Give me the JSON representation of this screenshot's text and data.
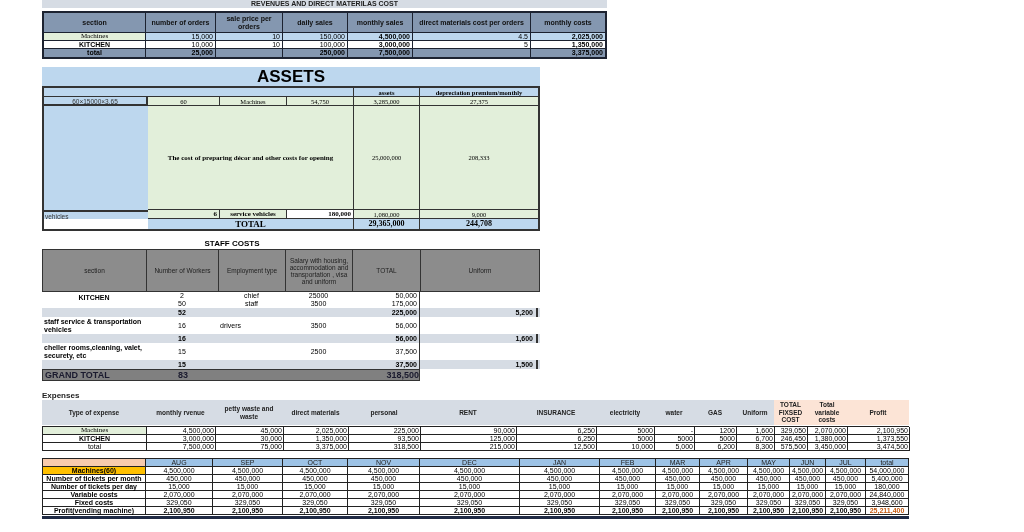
{
  "revenue_table": {
    "title": "REVENUES AND DIRECT MATERILAS COST",
    "columns": [
      "section",
      "number of orders",
      "sale price per orders",
      "daily sales",
      "monthly sales",
      "direct materials cost per orders",
      "monthly costs"
    ],
    "rows": [
      {
        "kind": "green",
        "cells": [
          "Machines",
          "15,000",
          "10",
          "150,000",
          "4,500,000",
          "4.5",
          "2,025,000"
        ]
      },
      {
        "kind": "plain",
        "cells": [
          "KITCHEN",
          "10,000",
          "10",
          "100,000",
          "3,000,000",
          "5",
          "1,350,000"
        ]
      },
      {
        "kind": "total",
        "cells": [
          "total",
          "25,000",
          null,
          "250,000",
          "7,500,000",
          null,
          "3,375,000"
        ]
      }
    ]
  },
  "assets": {
    "title": "ASSETS",
    "columns": [
      "assets",
      "depreciation premium/monthly"
    ],
    "rows": [
      {
        "kind": "machine",
        "label": "60×15000×3.65",
        "quantity": "60",
        "item": "Machines",
        "unit_price": "54,750",
        "assets": "3,285,000",
        "depreciation": "27,375"
      },
      {
        "kind": "opening",
        "item": "The cost of preparing décor and other costs for opening",
        "assets": "25,000,000",
        "depreciation": "208,333"
      },
      {
        "kind": "vehicle",
        "label": "vehicles",
        "quantity": "6",
        "item": "service vehicles",
        "unit_price": "180,000",
        "assets": "1,080,000",
        "depreciation": "9,000"
      }
    ],
    "total": {
      "label": "TOTAL",
      "assets": "29,365,000",
      "depreciation": "244,708"
    }
  },
  "staff_costs": {
    "title": "STAFF COSTS",
    "columns": [
      "section",
      "Number of Workers",
      "Employment type",
      "Salary with housing, accommodation and transportation , visa and uniform",
      "TOTAL",
      "Uniform"
    ],
    "groups": [
      {
        "section": "KITCHEN",
        "lines": [
          {
            "workers": "2",
            "type": "chief",
            "salary": "25000",
            "total": "50,000"
          },
          {
            "workers": "50",
            "type": "staff",
            "salary": "3500",
            "total": "175,000"
          }
        ],
        "subtotal": {
          "workers": "52",
          "total": "225,000",
          "uniform": "5,200"
        }
      },
      {
        "section": "staff service & transportation vehicles",
        "lines": [
          {
            "workers": "16",
            "type": "drivers",
            "salary": "3500",
            "total": "56,000"
          }
        ],
        "subtotal": {
          "workers": "16",
          "total": "56,000",
          "uniform": "1,600"
        }
      },
      {
        "section": "cheller rooms,cleaning, valet, securety, etc",
        "lines": [
          {
            "workers": "15",
            "salary": "2500",
            "total": "37,500"
          }
        ],
        "subtotal": {
          "workers": "15",
          "total": "37,500",
          "uniform": "1,500"
        }
      }
    ],
    "grand_total": {
      "label": "GRAND TOTAL",
      "workers": "83",
      "total": "318,500"
    }
  },
  "expenses": {
    "title": "Expenses",
    "columns": [
      {
        "label": "Type of expense",
        "highlighted": false
      },
      {
        "label": "monthly rvenue",
        "highlighted": false
      },
      {
        "label": "petty waste and waste",
        "highlighted": false
      },
      {
        "label": "direct materials",
        "highlighted": false
      },
      {
        "label": "personal",
        "highlighted": false
      },
      {
        "label": "RENT",
        "highlighted": false
      },
      {
        "label": "INSURANCE",
        "highlighted": false
      },
      {
        "label": "electricity",
        "highlighted": false
      },
      {
        "label": "water",
        "highlighted": false
      },
      {
        "label": "GAS",
        "highlighted": false
      },
      {
        "label": "Uniform",
        "highlighted": false
      },
      {
        "label": "TOTAL FIXSED COST",
        "highlighted": true
      },
      {
        "label": "Total variable costs",
        "highlighted": true
      },
      {
        "label": "Profit",
        "highlighted": true
      }
    ],
    "rows": [
      {
        "kind": "green",
        "cells": [
          "Machines",
          "4,500,000",
          "45,000",
          "2,025,000",
          "225,000",
          "90,000",
          "6,250",
          "5000",
          "-",
          "1200",
          "1,600",
          "329,050",
          "2,070,000",
          "2,100,950"
        ]
      },
      {
        "kind": "bold",
        "cells": [
          "KITCHEN",
          "3,000,000",
          "30,000",
          "1,350,000",
          "93,500",
          "125,000",
          "6,250",
          "5000",
          "5000",
          "5000",
          "6,700",
          "246,450",
          "1,380,000",
          "1,373,550"
        ]
      },
      {
        "kind": "plain",
        "cells": [
          "total",
          "7,500,000",
          "75,000",
          "3,375,000",
          "318,500",
          "215,000",
          "12,500",
          "10,000",
          "5,000",
          "6,200",
          "8,300",
          "575,500",
          "3,450,000",
          "3,474,500"
        ]
      }
    ]
  },
  "monthly_table": {
    "columns": [
      "AUG",
      "SEP",
      "OCT",
      "NOV",
      "DEC",
      "JAN",
      "FEB",
      "MAR",
      "APR",
      "MAY",
      "JUN",
      "JUL",
      "total"
    ],
    "rows": [
      {
        "kind": "highlight",
        "label": "Machines(60)",
        "cells": [
          "4,500,000",
          "4,500,000",
          "4,500,000",
          "4,500,000",
          "4,500,000",
          "4,500,000",
          "4,500,000",
          "4,500,000",
          "4,500,000",
          "4,500,000",
          "4,500,000",
          "4,500,000",
          "54,000,000"
        ]
      },
      {
        "kind": "plain",
        "label": "Number of tickets per month",
        "cells": [
          "450,000",
          "450,000",
          "450,000",
          "450,000",
          "450,000",
          "450,000",
          "450,000",
          "450,000",
          "450,000",
          "450,000",
          "450,000",
          "450,000",
          "5,400,000"
        ]
      },
      {
        "kind": "plain",
        "label": "Number of tickets per day",
        "cells": [
          "15,000",
          "15,000",
          "15,000",
          "15,000",
          "15,000",
          "15,000",
          "15,000",
          "15,000",
          "15,000",
          "15,000",
          "15,000",
          "15,000",
          "180,000"
        ]
      },
      {
        "kind": "plain",
        "label": "Variable costs",
        "cells": [
          "2,070,000",
          "2,070,000",
          "2,070,000",
          "2,070,000",
          "2,070,000",
          "2,070,000",
          "2,070,000",
          "2,070,000",
          "2,070,000",
          "2,070,000",
          "2,070,000",
          "2,070,000",
          "24,840,000"
        ]
      },
      {
        "kind": "plain",
        "label": "Fixed costs",
        "cells": [
          "329,050",
          "329,050",
          "329,050",
          "329,050",
          "329,050",
          "329,050",
          "329,050",
          "329,050",
          "329,050",
          "329,050",
          "329,050",
          "329,050",
          "3,948,600"
        ]
      },
      {
        "kind": "profit",
        "label": "Profit(vending machine)",
        "cells": [
          "2,100,950",
          "2,100,950",
          "2,100,950",
          "2,100,950",
          "2,100,950",
          "2,100,950",
          "2,100,950",
          "2,100,950",
          "2,100,950",
          "2,100,950",
          "2,100,950",
          "2,100,950",
          "25,211,400"
        ]
      }
    ]
  }
}
